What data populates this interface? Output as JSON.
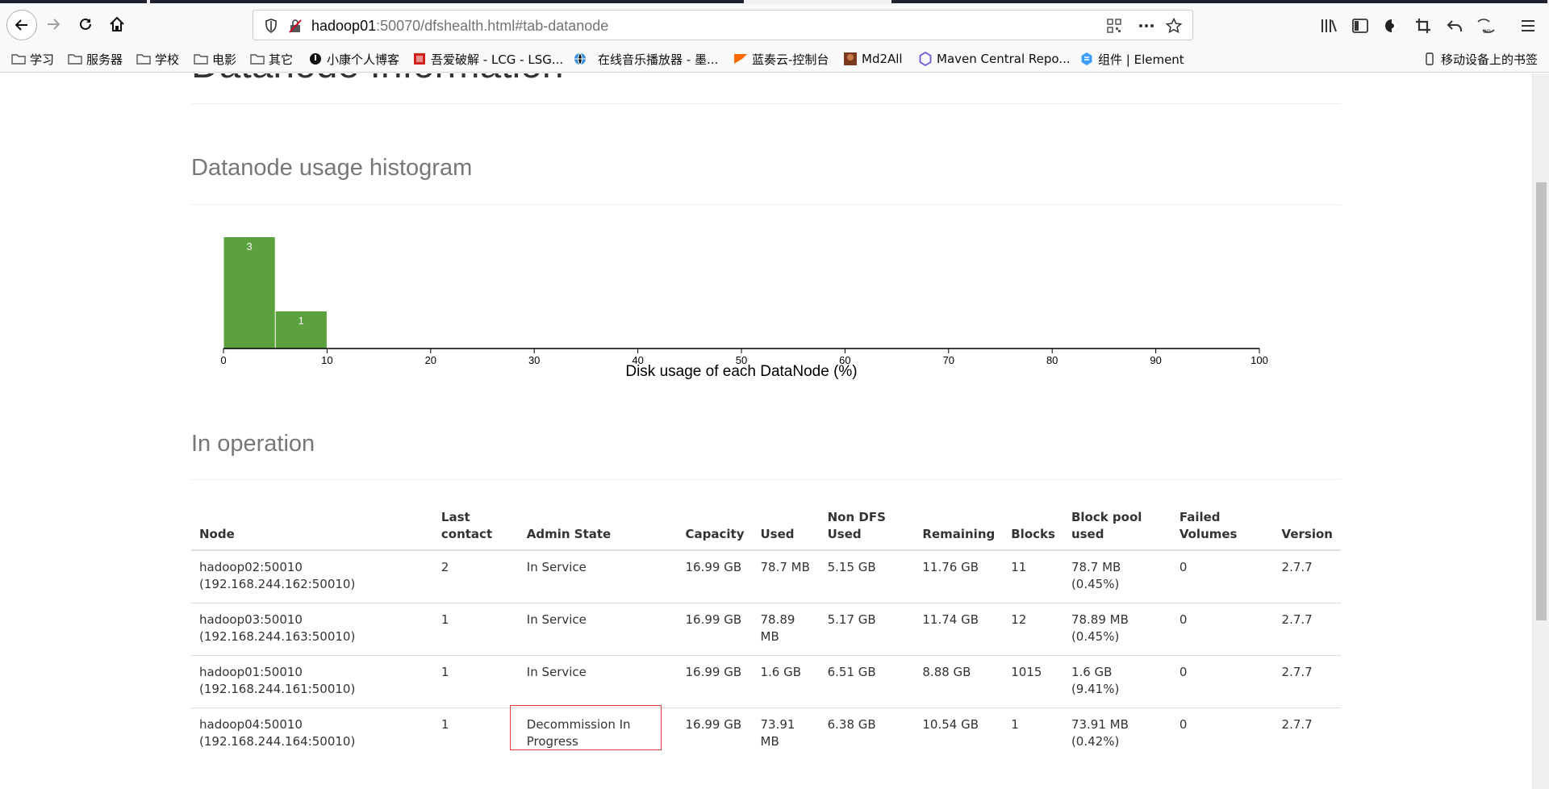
{
  "browser": {
    "url_host": "hadoop01",
    "url_rest": ":50070/dfshealth.html#tab-datanode",
    "bookmarks": [
      "学习",
      "服务器",
      "学校",
      "电影",
      "其它",
      "小康个人博客",
      "吾爱破解 - LCG - LSG...",
      "在线音乐播放器 - 墨...",
      "蓝奏云-控制台",
      "Md2All",
      "Maven Central Repo...",
      "组件 | Element"
    ],
    "bookmarks_right": "移动设备上的书签"
  },
  "page": {
    "partial_heading": "Datanode Information",
    "histogram_title": "Datanode usage histogram",
    "in_operation_title": "In operation"
  },
  "chart_data": {
    "type": "bar",
    "title": "Datanode usage histogram",
    "xlabel": "Disk usage of each DataNode (%)",
    "ylabel": "",
    "xlim": [
      0,
      100
    ],
    "xticks": [
      "0",
      "10",
      "20",
      "30",
      "40",
      "50",
      "60",
      "70",
      "80",
      "90",
      "100"
    ],
    "bins": [
      {
        "from": 0,
        "to": 5,
        "count": 3
      },
      {
        "from": 5,
        "to": 10,
        "count": 1
      }
    ],
    "bar_color": "#5ba23e"
  },
  "table": {
    "headers": [
      "Node",
      "Last contact",
      "Admin State",
      "Capacity",
      "Used",
      "Non DFS Used",
      "Remaining",
      "Blocks",
      "Block pool used",
      "Failed Volumes",
      "Version"
    ],
    "rows": [
      [
        "hadoop02:50010 (192.168.244.162:50010)",
        "2",
        "In Service",
        "16.99 GB",
        "78.7 MB",
        "5.15 GB",
        "11.76 GB",
        "11",
        "78.7 MB (0.45%)",
        "0",
        "2.7.7"
      ],
      [
        "hadoop03:50010 (192.168.244.163:50010)",
        "1",
        "In Service",
        "16.99 GB",
        "78.89 MB",
        "5.17 GB",
        "11.74 GB",
        "12",
        "78.89 MB (0.45%)",
        "0",
        "2.7.7"
      ],
      [
        "hadoop01:50010 (192.168.244.161:50010)",
        "1",
        "In Service",
        "16.99 GB",
        "1.6 GB",
        "6.51 GB",
        "8.88 GB",
        "1015",
        "1.6 GB (9.41%)",
        "0",
        "2.7.7"
      ],
      [
        "hadoop04:50010 (192.168.244.164:50010)",
        "1",
        "Decommission In Progress",
        "16.99 GB",
        "73.91 MB",
        "6.38 GB",
        "10.54 GB",
        "1",
        "73.91 MB (0.42%)",
        "0",
        "2.7.7"
      ]
    ]
  }
}
